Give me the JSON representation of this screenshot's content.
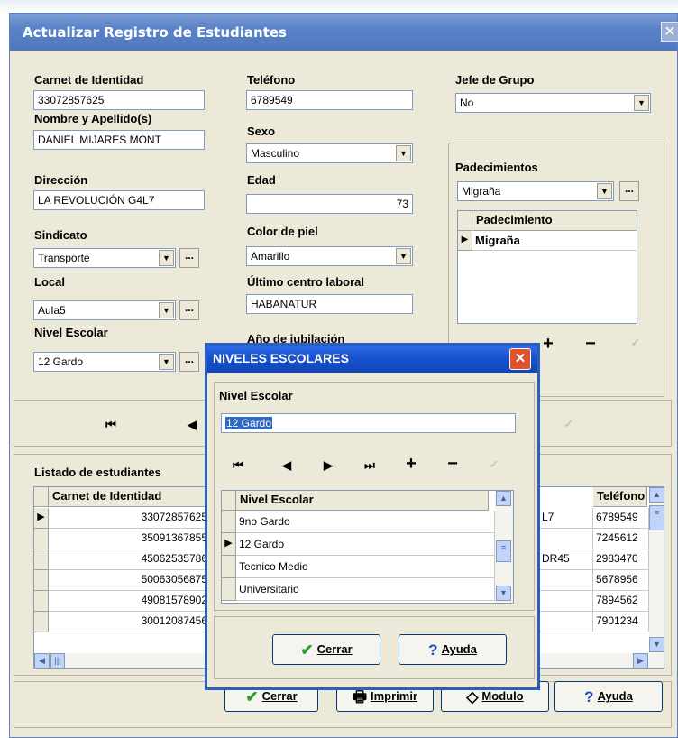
{
  "window": {
    "title": "Actualizar Registro de Estudiantes"
  },
  "form": {
    "carnet_label": "Carnet de Identidad",
    "carnet_value": "33072857625",
    "nombre_label": "Nombre y Apellido(s)",
    "nombre_value": "DANIEL MIJARES MONT",
    "direccion_label": "Dirección",
    "direccion_value": "LA REVOLUCIÓN G4L7",
    "sindicato_label": "Sindicato",
    "sindicato_value": "Transporte",
    "local_label": "Local",
    "local_value": "Aula5",
    "nivel_label": "Nivel Escolar",
    "nivel_value": "12 Gardo",
    "telefono_label": "Teléfono",
    "telefono_value": "6789549",
    "sexo_label": "Sexo",
    "sexo_value": "Masculino",
    "edad_label": "Edad",
    "edad_value": "73",
    "color_label": "Color de piel",
    "color_value": "Amarillo",
    "centro_label": "Último centro laboral",
    "centro_value": "HABANATUR",
    "jubilacion_label": "Año de jubilación",
    "jefe_label": "Jefe de Grupo",
    "jefe_value": "No",
    "padecimientos_label": "Padecimientos",
    "padecimientos_value": "Migraña",
    "dots": "..."
  },
  "padecimientos_grid": {
    "header": "Padecimiento",
    "rows": [
      "Migraña"
    ]
  },
  "listado": {
    "title": "Listado de estudiantes",
    "col_carnet": "Carnet de Identidad",
    "col_telefono": "Teléfono",
    "rows": [
      {
        "carnet": "33072857625",
        "extra": "L7",
        "tel": "6789549"
      },
      {
        "carnet": "35091367855",
        "extra": "",
        "tel": "7245612"
      },
      {
        "carnet": "45062535786",
        "extra": "DR45",
        "tel": "2983470"
      },
      {
        "carnet": "50063056875",
        "extra": "",
        "tel": "5678956"
      },
      {
        "carnet": "49081578902",
        "extra": "",
        "tel": "7894562"
      },
      {
        "carnet": "30012087456",
        "extra": "",
        "tel": "7901234"
      }
    ]
  },
  "footer": {
    "cerrar": "Cerrar",
    "imprimir": "Imprimir",
    "modulo": "Modulo",
    "ayuda": "Ayuda"
  },
  "dialog": {
    "title": "NIVELES ESCOLARES",
    "field_label": "Nivel Escolar",
    "field_value": "12 Gardo",
    "grid_header": "Nivel Escolar",
    "rows": [
      "9no Gardo",
      "12 Gardo",
      "Tecnico Medio",
      "Universitario"
    ],
    "cerrar": "Cerrar",
    "ayuda": "Ayuda"
  },
  "colors": {
    "title_blue": "#4f78c0",
    "dialog_blue": "#1a54d0",
    "selection": "#316ac5",
    "face": "#ece9d8"
  },
  "icons": [
    "close-icon",
    "dropdown-arrow-icon",
    "first-record-icon",
    "prev-record-icon",
    "next-record-icon",
    "last-record-icon",
    "add-icon",
    "delete-icon",
    "check-icon",
    "help-icon",
    "printer-icon",
    "scroll-up-icon",
    "scroll-down-icon"
  ]
}
